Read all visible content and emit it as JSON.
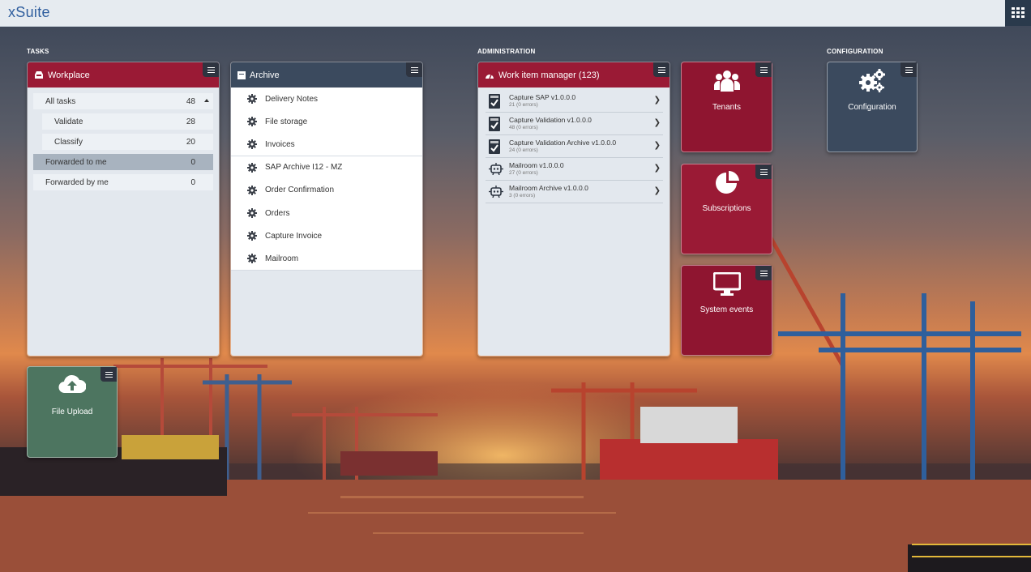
{
  "app": {
    "logo": "xSuite"
  },
  "sections": {
    "tasks": "TASKS",
    "administration": "ADMINISTRATION",
    "configuration": "CONFIGURATION"
  },
  "workplace": {
    "title": "Workplace",
    "items": [
      {
        "label": "All tasks",
        "count": "48"
      },
      {
        "label": "Validate",
        "count": "28"
      },
      {
        "label": "Classify",
        "count": "20"
      },
      {
        "label": "Forwarded to me",
        "count": "0"
      },
      {
        "label": "Forwarded by me",
        "count": "0"
      }
    ]
  },
  "archive": {
    "title": "Archive",
    "items": [
      "Delivery Notes",
      "File storage",
      "Invoices",
      "SAP Archive I12 - MZ",
      "Order Confirmation",
      "Orders",
      "Capture Invoice",
      "Mailroom"
    ]
  },
  "work_items": {
    "title": "Work item manager (123)",
    "items": [
      {
        "name": "Capture SAP v1.0.0.0",
        "errors": "21 (0 errors)",
        "icon": "checklist-icon"
      },
      {
        "name": "Capture Validation v1.0.0.0",
        "errors": "48 (0 errors)",
        "icon": "checklist-icon"
      },
      {
        "name": "Capture Validation Archive v1.0.0.0",
        "errors": "24 (0 errors)",
        "icon": "checklist-icon"
      },
      {
        "name": "Mailroom v1.0.0.0",
        "errors": "27 (0 errors)",
        "icon": "robot-icon"
      },
      {
        "name": "Mailroom Archive v1.0.0.0",
        "errors": "3 (0 errors)",
        "icon": "robot-icon"
      }
    ]
  },
  "tiles": {
    "tenants": "Tenants",
    "subscriptions": "Subscriptions",
    "system_events": "System events",
    "configuration": "Configuration",
    "file_upload": "File Upload"
  },
  "colors": {
    "crimson": "#9a1a35",
    "slate": "#3b4a5e",
    "upload_green": "#4d7560",
    "topbar": "#e6ebf0"
  }
}
